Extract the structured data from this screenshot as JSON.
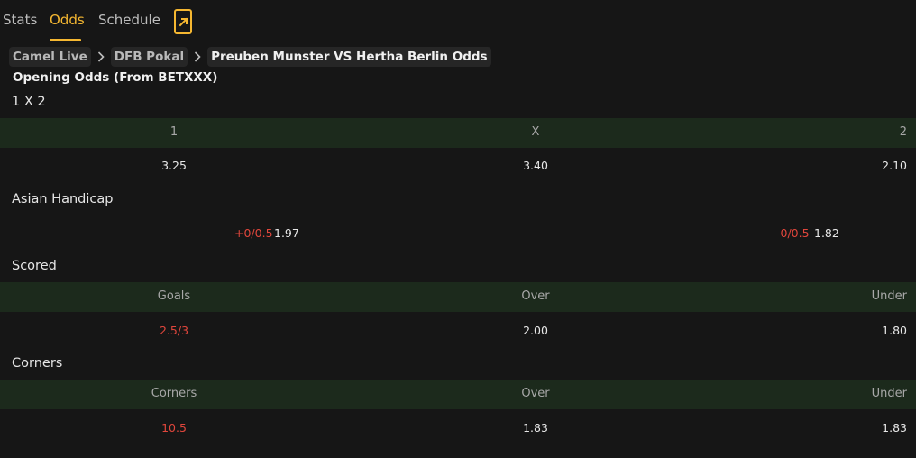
{
  "tabs": [
    {
      "label": "Stats"
    },
    {
      "label": "Odds"
    },
    {
      "label": "Schedule"
    }
  ],
  "active_tab": "Odds",
  "icons": {
    "share": "share-out-icon",
    "chevron": "chevron-right-icon"
  },
  "colors": {
    "accent": "#f5b731",
    "header_bg": "#1c2a1c",
    "negative": "#e0463c",
    "background": "#161616"
  },
  "breadcrumb": {
    "items": [
      "Camel Live",
      "DFB Pokal",
      "Preuben Munster VS Hertha Berlin Odds"
    ]
  },
  "opening_title": "Opening Odds (From BETXXX)",
  "one_x_two": {
    "title": "1 X 2",
    "headers": [
      "1",
      "X",
      "2"
    ],
    "values": [
      "3.25",
      "3.40",
      "2.10"
    ]
  },
  "asian_handicap": {
    "title": "Asian Handicap",
    "home": {
      "line": "+0/0.5",
      "odds": "1.97"
    },
    "away": {
      "line": "-0/0.5",
      "odds": "1.82"
    }
  },
  "scored": {
    "title": "Scored",
    "headers": [
      "Goals",
      "Over",
      "Under"
    ],
    "values": [
      "2.5/3",
      "2.00",
      "1.80"
    ]
  },
  "corners": {
    "title": "Corners",
    "headers": [
      "Corners",
      "Over",
      "Under"
    ],
    "values": [
      "10.5",
      "1.83",
      "1.83"
    ]
  }
}
